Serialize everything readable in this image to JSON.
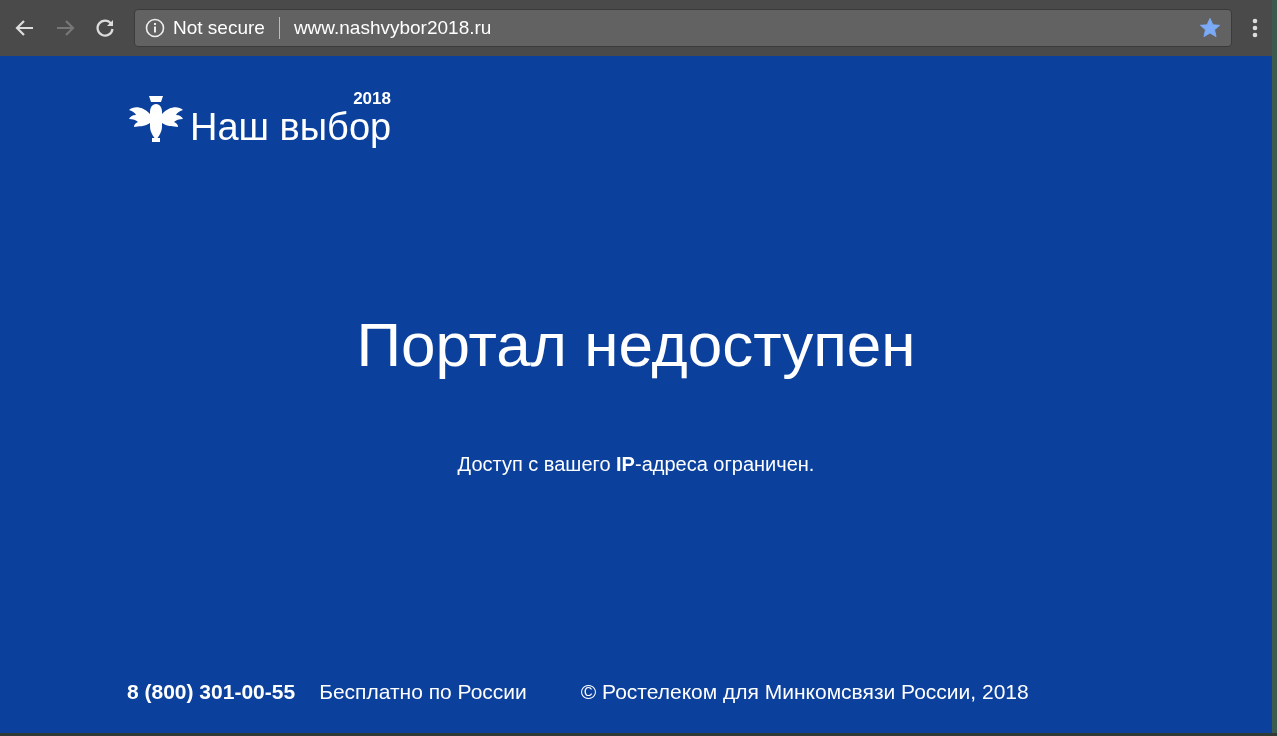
{
  "browser": {
    "security_label": "Not secure",
    "url": "www.nashvybor2018.ru",
    "bookmarked": true
  },
  "logo": {
    "name": "Наш выбор",
    "year": "2018"
  },
  "title": "Портал недоступен",
  "message": "Доступ с вашего **IP**-адреса ограничен.",
  "footer": {
    "phone": "8 (800) 301-00-55",
    "phone_note": "Бесплатно по России",
    "copyright": "© Ростелеком для Минкомсвязи России, 2018"
  }
}
